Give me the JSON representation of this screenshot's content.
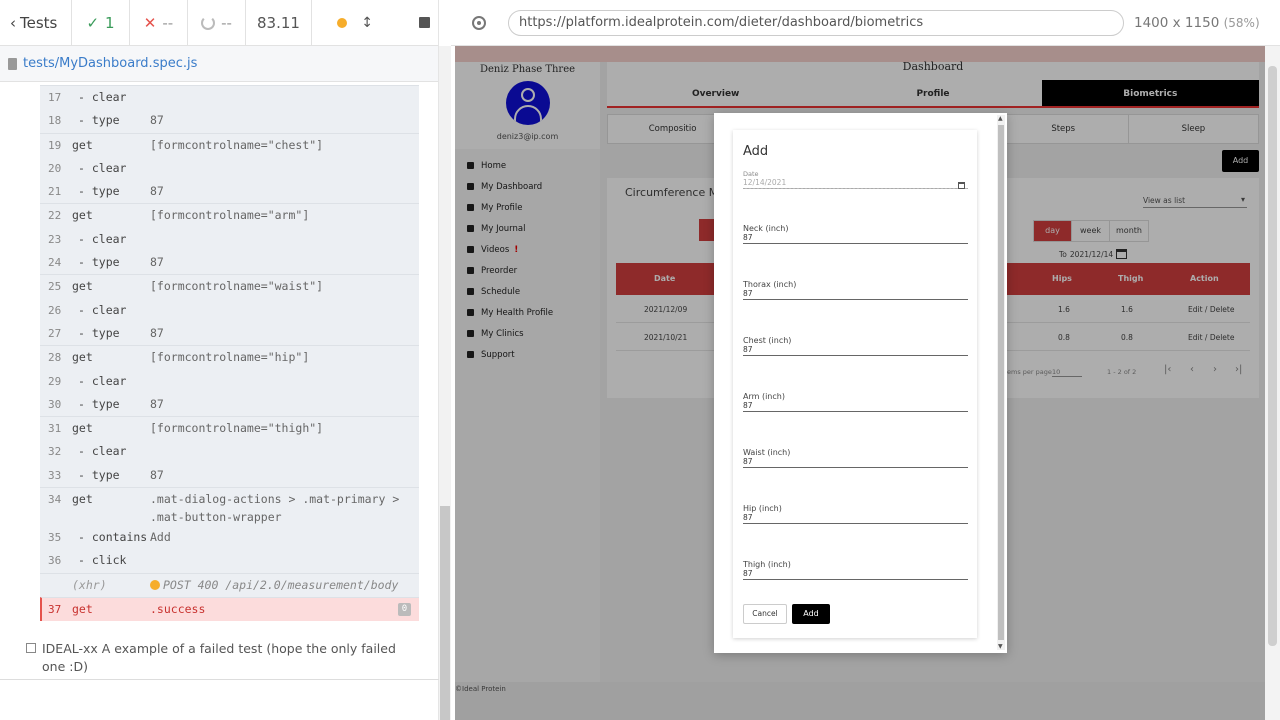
{
  "reporter": {
    "tests_label": "Tests",
    "passed": "1",
    "failed": "--",
    "pending": "--",
    "duration": "83.11",
    "spec_path": "tests/MyDashboard.spec.js",
    "commands": [
      {
        "num": "17",
        "name": "- clear",
        "msg": "",
        "child": true
      },
      {
        "num": "18",
        "name": "- type",
        "msg": "87",
        "child": true
      },
      {
        "num": "19",
        "name": "get",
        "msg": "[formcontrolname=\"chest\"]",
        "child": false
      },
      {
        "num": "20",
        "name": "- clear",
        "msg": "",
        "child": true
      },
      {
        "num": "21",
        "name": "- type",
        "msg": "87",
        "child": true
      },
      {
        "num": "22",
        "name": "get",
        "msg": "[formcontrolname=\"arm\"]",
        "child": false
      },
      {
        "num": "23",
        "name": "- clear",
        "msg": "",
        "child": true
      },
      {
        "num": "24",
        "name": "- type",
        "msg": "87",
        "child": true
      },
      {
        "num": "25",
        "name": "get",
        "msg": "[formcontrolname=\"waist\"]",
        "child": false
      },
      {
        "num": "26",
        "name": "- clear",
        "msg": "",
        "child": true
      },
      {
        "num": "27",
        "name": "- type",
        "msg": "87",
        "child": true
      },
      {
        "num": "28",
        "name": "get",
        "msg": "[formcontrolname=\"hip\"]",
        "child": false
      },
      {
        "num": "29",
        "name": "- clear",
        "msg": "",
        "child": true
      },
      {
        "num": "30",
        "name": "- type",
        "msg": "87",
        "child": true
      },
      {
        "num": "31",
        "name": "get",
        "msg": "[formcontrolname=\"thigh\"]",
        "child": false
      },
      {
        "num": "32",
        "name": "- clear",
        "msg": "",
        "child": true
      },
      {
        "num": "33",
        "name": "- type",
        "msg": "87",
        "child": true
      },
      {
        "num": "34",
        "name": "get",
        "msg": ".mat-dialog-actions > .mat-primary > .mat-button-wrapper",
        "child": false
      },
      {
        "num": "35",
        "name": "- contains",
        "msg": "Add",
        "child": true
      },
      {
        "num": "36",
        "name": "- click",
        "msg": "",
        "child": true
      }
    ],
    "xhr": {
      "name": "(xhr)",
      "msg": "POST 400 /api/2.0/measurement/body"
    },
    "failed_cmd": {
      "num": "37",
      "name": "get",
      "msg": ".success",
      "count": "0"
    },
    "failed_test_title": "IDEAL-xx A example of a failed test (hope the only failed one :D)"
  },
  "browser": {
    "url": "https://platform.idealprotein.com/dieter/dashboard/biometrics",
    "viewport": "1400 x 1150",
    "zoom": "(58%)"
  },
  "app": {
    "user_name": "Deniz Phase Three",
    "user_email": "deniz3@ip.com",
    "nav": [
      "Home",
      "My Dashboard",
      "My Profile",
      "My Journal",
      "Videos",
      "Preorder",
      "Schedule",
      "My Health Profile",
      "My Clinics",
      "Support"
    ],
    "videos_badge": "!",
    "dashboard_title": "Dashboard",
    "tabs": [
      "Overview",
      "Profile",
      "Biometrics"
    ],
    "subtabs": [
      "Compositio",
      "",
      "",
      "Steps",
      "Sleep"
    ],
    "bg_add": "Add",
    "panel_title": "Circumference Me",
    "view_select": "View as list",
    "periods": [
      "day",
      "week",
      "month"
    ],
    "to_label": "To",
    "to_date": "2021/12/14",
    "table_headers": {
      "date": "Date",
      "hips": "Hips",
      "thigh": "Thigh",
      "action": "Action"
    },
    "rows": [
      {
        "date": "2021/12/09",
        "hips": "1.6",
        "thigh": "1.6",
        "action": "Edit / Delete"
      },
      {
        "date": "2021/10/21",
        "hips": "0.8",
        "thigh": "0.8",
        "action": "Edit / Delete"
      }
    ],
    "paginator": {
      "items_label": "ems per page",
      "per_page": "10",
      "range": "1 - 2 of 2"
    },
    "footer": "©Ideal Protein"
  },
  "dialog": {
    "title": "Add",
    "date_label": "Date",
    "date_value": "12/14/2021",
    "fields": [
      {
        "label": "Neck (inch)",
        "value": "87"
      },
      {
        "label": "Thorax (inch)",
        "value": "87"
      },
      {
        "label": "Chest (inch)",
        "value": "87"
      },
      {
        "label": "Arm (inch)",
        "value": "87"
      },
      {
        "label": "Waist (inch)",
        "value": "87"
      },
      {
        "label": "Hip (inch)",
        "value": "87"
      },
      {
        "label": "Thigh (inch)",
        "value": "87"
      }
    ],
    "cancel_label": "Cancel",
    "add_label": "Add"
  },
  "colors": {
    "accent_red": "#d13f3f",
    "dialog_primary": "#000000",
    "avatar_blue": "#1010d8"
  }
}
